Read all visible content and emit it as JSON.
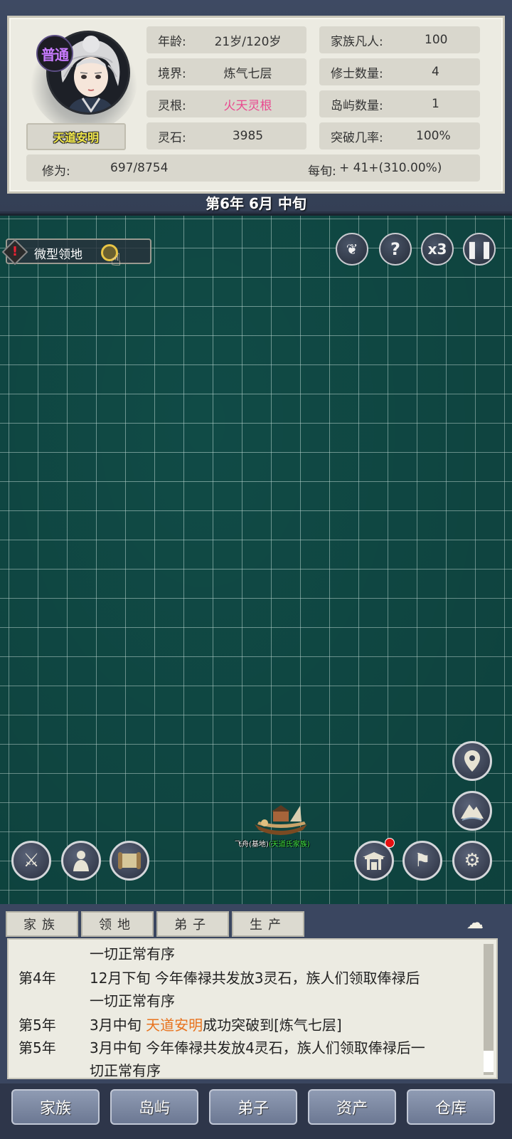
{
  "character": {
    "rank_badge": "普通",
    "name": "天道安明",
    "stats": {
      "age": {
        "label": "年龄:",
        "value": "21岁/120岁"
      },
      "realm": {
        "label": "境界:",
        "value": "炼气七层"
      },
      "spirit_root": {
        "label": "灵根:",
        "value": "火天灵根"
      },
      "spirit_stones": {
        "label": "灵石:",
        "value": "3985"
      },
      "clan_mortals": {
        "label": "家族凡人:",
        "value": "100"
      },
      "cultivators": {
        "label": "修士数量:",
        "value": "4"
      },
      "islands": {
        "label": "岛屿数量:",
        "value": "1"
      },
      "breakthrough": {
        "label": "突破几率:",
        "value": "100%"
      }
    },
    "cultivation": {
      "label": "修为:",
      "value": "697/8754",
      "rate_label": "每旬:",
      "rate_value": "+ 41+(310.00%)"
    }
  },
  "date": "第6年 6月 中旬",
  "map": {
    "quest": {
      "label": "微型领地"
    },
    "top_buttons": {
      "speed": "x3"
    },
    "ship_label": {
      "name": "飞舟(基地)",
      "clan": "(天道氏家族)"
    },
    "icons": {
      "quest_alert": "exclamation-icon",
      "achievement": "laurel-icon",
      "help": "question-icon",
      "speed": "speed-icon",
      "pause": "pause-icon",
      "location": "map-pin-icon",
      "mountain": "mountain-icon",
      "battle": "crossed-swords-icon",
      "character": "cultivator-icon",
      "scroll": "scroll-icon",
      "sect": "gate-icon",
      "flag": "flag-icon",
      "settings": "gear-icon"
    }
  },
  "log": {
    "tabs": [
      "家族",
      "领地",
      "弟子",
      "生产"
    ],
    "entries": [
      {
        "year": "",
        "text": "一切正常有序"
      },
      {
        "year": "第4年",
        "text": "12月下旬 今年俸禄共发放3灵石，族人们领取俸禄后"
      },
      {
        "year": "",
        "text": "一切正常有序"
      },
      {
        "year": "第5年",
        "pre": "3月中旬 ",
        "highlight": "天道安明",
        "post": "成功突破到[炼气七层]"
      },
      {
        "year": "第5年",
        "text": "3月中旬 今年俸禄共发放4灵石，族人们领取俸禄后一"
      },
      {
        "year": "",
        "text": "切正常有序"
      }
    ]
  },
  "nav": [
    "家族",
    "岛屿",
    "弟子",
    "资产",
    "仓库"
  ],
  "colors": {
    "map_bg": "#114f4a",
    "spirit_root": "#e9498f",
    "name_highlight": "#e8731e",
    "badge": "#c87bff"
  }
}
